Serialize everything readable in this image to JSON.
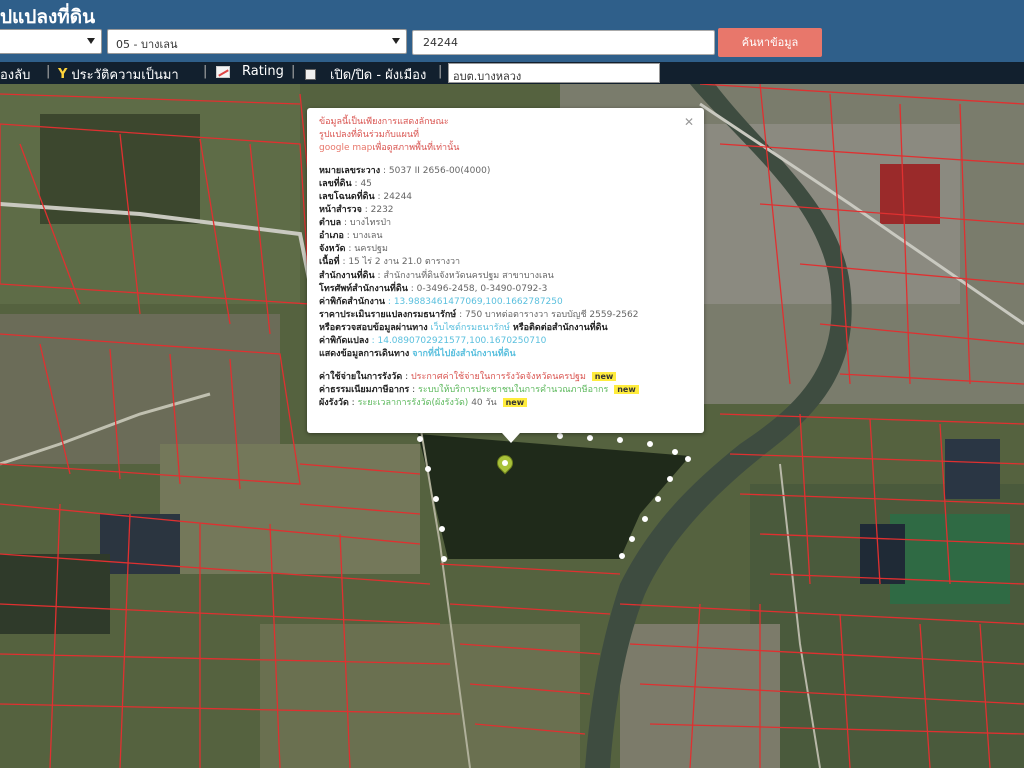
{
  "header": {
    "title": "ปแปลงที่ดิน",
    "amphoe_select": "05 - บางเลน",
    "parcel_input": "24244",
    "search_button": "ค้นหาข้อมูล"
  },
  "toolbar": {
    "item_left": "องลับ",
    "history": "ประวัติความเป็นมา",
    "rating": "Rating",
    "toggle": "เปิด/ปิด - ผังเมือง",
    "search_value": "อบต.บางหลวง"
  },
  "popup": {
    "warning_line1": "ข้อมูลนี้เป็นเพียงการแสดงลักษณะ",
    "warning_line2": "รูปแปลงที่ดินร่วมกับแผนที่",
    "warning_line3_link": "google map",
    "warning_line3_rest": "เพื่อดูสภาพพื้นที่เท่านั้น",
    "rows": [
      {
        "label": "หมายเลขระวาง",
        "value": " : 5037 II 2656-00(4000)"
      },
      {
        "label": "เลขที่ดิน",
        "value": " : 45"
      },
      {
        "label": "เลขโฉนดที่ดิน",
        "value": " : 24244"
      },
      {
        "label": "หน้าสำรวจ",
        "value": " : 2232"
      },
      {
        "label": "ตำบล",
        "value": " : บางไทรป่า"
      },
      {
        "label": "อำเภอ",
        "value": " : บางเลน"
      },
      {
        "label": "จังหวัด",
        "value": " : นครปฐม"
      },
      {
        "label": "เนื้อที่",
        "value": " : 15 ไร่ 2 งาน 21.0 ตารางวา"
      },
      {
        "label": "สำนักงานที่ดิน",
        "value": " : สำนักงานที่ดินจังหวัดนครปฐม สาขาบางเลน"
      },
      {
        "label": "โทรศัพท์สำนักงานที่ดิน",
        "value": " : 0-3496-2458, 0-3490-0792-3"
      }
    ],
    "office_coord_label": "ค่าพิกัดสำนักงาน",
    "office_coord_value": " : 13.9883461477069,100.1662787250",
    "price_label": "ราคาประเมินรายแปลงกรมธนารักษ์",
    "price_value": " : 750 บาทต่อตารางวา รอบบัญชี 2559-2562",
    "check_text": "หรือตรวจสอบข้อมูลผ่านทาง",
    "check_link": "เว็บไซต์กรมธนารักษ์",
    "check_rest": "หรือติดต่อสำนักงานที่ดิน",
    "land_coord_label": "ค่าพิกัดแปลง",
    "land_coord_value": " : 14.0890702921577,100.1670250710",
    "route_label": "แสดงข้อมูลการเดินทาง",
    "route_link": "จากที่นี่ไปยังสำนักงานที่ดิน",
    "fee_label": "ค่าใช้จ่ายในการรังวัด",
    "fee_link": "ประกาศค่าใช้จ่ายในการรังวัดจังหวัดนครปฐม",
    "tax_label": "ค่าธรรมเนียมภาษีอากร",
    "tax_link": "ระบบให้บริการประชาชนในการคำนวณภาษีอากร",
    "time_label": "ผังรังวัด",
    "time_link": "ระยะเวลาการรังวัด(ผังรังวัด)",
    "time_value": " 40 วัน",
    "new_badge": "new"
  },
  "colors": {
    "header_bg": "#2f5f8a",
    "toolbar_bg": "#12202e",
    "button_bg": "#e8776b",
    "parcel_line": "#e03030"
  },
  "icons": [
    "chevron-down-icon",
    "history-icon",
    "chart-icon",
    "checkbox-icon",
    "close-icon",
    "map-pin-icon"
  ]
}
